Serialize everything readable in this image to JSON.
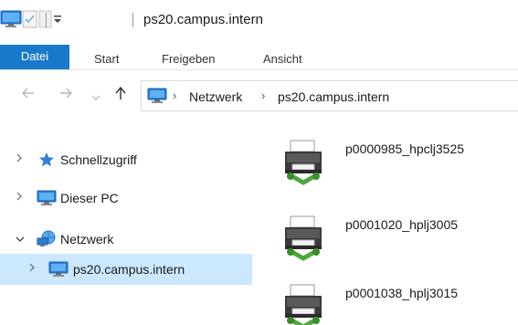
{
  "window": {
    "title": "ps20.campus.intern"
  },
  "ribbon": {
    "tabs": [
      {
        "label": "Datei"
      },
      {
        "label": "Start"
      },
      {
        "label": "Freigeben"
      },
      {
        "label": "Ansicht"
      }
    ]
  },
  "address_bar": {
    "crumbs": [
      "Netzwerk",
      "ps20.campus.intern"
    ]
  },
  "sidebar": {
    "items": [
      {
        "label": "Schnellzugriff",
        "icon": "star-icon",
        "expanded": false
      },
      {
        "label": "Dieser PC",
        "icon": "computer-icon",
        "expanded": false
      },
      {
        "label": "Netzwerk",
        "icon": "network-icon",
        "expanded": true
      },
      {
        "label": "ps20.campus.intern",
        "icon": "computer-icon",
        "expanded": false,
        "selected": true
      }
    ]
  },
  "content": {
    "printers": [
      {
        "name": "p0000985_hpclj3525"
      },
      {
        "name": "p0001020_hplj3005"
      },
      {
        "name": "p0001038_hplj3015"
      }
    ]
  },
  "colors": {
    "accent": "#1979ca",
    "selection": "#cce8ff",
    "printer_green": "#4fa83d"
  }
}
